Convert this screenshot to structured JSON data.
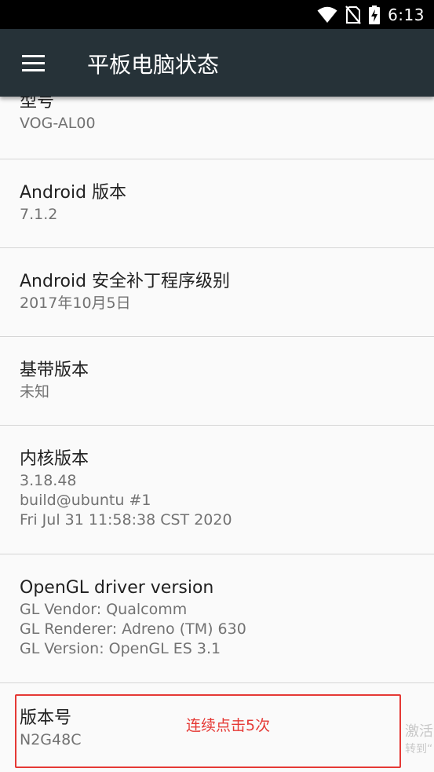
{
  "status_bar": {
    "time": "6:13",
    "icons": [
      "wifi-icon",
      "no-sim-icon",
      "battery-charging-icon"
    ]
  },
  "toolbar": {
    "title": "平板电脑状态"
  },
  "items": [
    {
      "title": "型号",
      "value": "VOG-AL00"
    },
    {
      "title": "Android 版本",
      "value": "7.1.2"
    },
    {
      "title": "Android 安全补丁程序级别",
      "value": "2017年10月5日"
    },
    {
      "title": "基带版本",
      "value": "未知"
    },
    {
      "title": "内核版本",
      "value": "3.18.48\nbuild@ubuntu #1\nFri Jul 31 11:58:38 CST 2020"
    },
    {
      "title": "OpenGL driver version",
      "value": "GL Vendor: Qualcomm\nGL Renderer: Adreno (TM) 630\nGL Version: OpenGL ES 3.1"
    },
    {
      "title": "版本号",
      "value": "N2G48C"
    }
  ],
  "annotation": {
    "hint": "连续点击5次",
    "color": "#e53935"
  },
  "watermark": {
    "line1": "激活",
    "line2": "转到“"
  }
}
